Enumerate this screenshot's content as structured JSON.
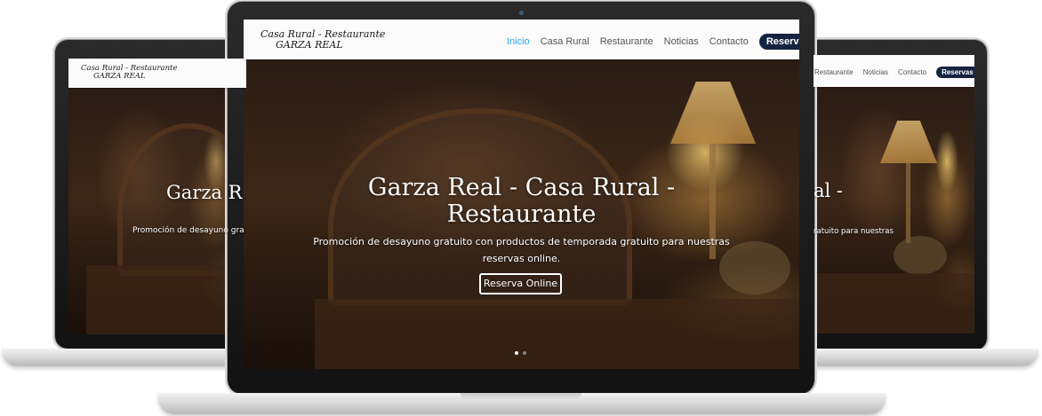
{
  "logo": {
    "line1": "Casa Rural - Restaurante",
    "line2": "GARZA REAL"
  },
  "nav": {
    "items": [
      "Inicio",
      "Casa Rural",
      "Restaurante",
      "Noticias",
      "Contacto"
    ],
    "active_index": 0,
    "cta": "Reservas"
  },
  "hero": {
    "title_line1": "Garza Real - Casa Rural -",
    "title_line2": "Restaurante",
    "subtitle_line1": "Promoción de desayuno gratuito con productos de temporada gratuito para nuestras",
    "subtitle_line2": "reservas online.",
    "button": "Reserva Online",
    "slide_count": 2,
    "active_slide": 0
  },
  "left_screen": {
    "title_fragment": "Garza R",
    "subtitle_fragment": "Promoción de desayuno gra"
  },
  "right_screen": {
    "nav_items": [
      "Restaurante",
      "Noticias",
      "Contacto"
    ],
    "title_fragment": "al -",
    "subtitle_fragment": "ratuito para nuestras"
  },
  "colors": {
    "accent": "#2ea3f2",
    "cta_bg": "#14233f",
    "header_bg": "#fbfbfb"
  }
}
